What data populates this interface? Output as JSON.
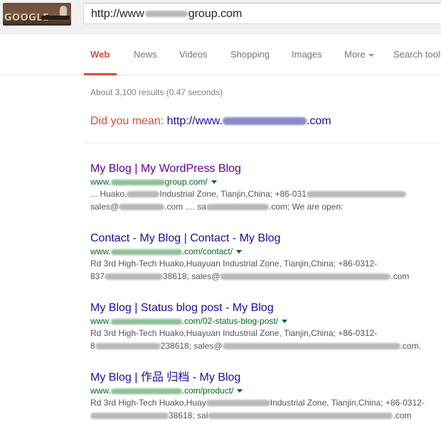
{
  "header": {
    "logo_text": "GOOGLE",
    "search_prefix": "http://www",
    "search_suffix": "group.com"
  },
  "nav": {
    "tabs": [
      {
        "label": "Web",
        "active": true
      },
      {
        "label": "News"
      },
      {
        "label": "Videos"
      },
      {
        "label": "Shopping"
      },
      {
        "label": "Images"
      },
      {
        "label": "More"
      },
      {
        "label": "Search tools"
      }
    ]
  },
  "stats": "About 3,100 results (0.47 seconds)",
  "did_you_mean": {
    "label": "Did you mean:",
    "prefix": "http://www.",
    "suffix": ".com"
  },
  "results": [
    {
      "title": "My Blog | My WordPress Blog",
      "url_prefix": "www.",
      "url_suffix": "group.com/",
      "snippet1_a": "... Huako,",
      "snippet1_b": "Industrial Zone, Tianjin,China; +86-031",
      "snippet2_a": "sales@",
      "snippet2_b": ".com .... sa",
      "snippet2_c": ".com; We are open:"
    },
    {
      "title": "Contact - My Blog | Contact - My Blog",
      "url_prefix": "www.",
      "url_suffix": ".com/contact/",
      "snippet1_a": "Rd 3rd High-Tech Huako,Huayuan Industrial Zone, Tianjin,China; +86-0312-",
      "snippet1_b": "",
      "snippet2_a": "837",
      "snippet2_b": "38618; sales@",
      "snippet2_c": ".com"
    },
    {
      "title": "My Blog | Status blog post - My Blog",
      "url_prefix": "www.",
      "url_suffix": ".com/02-status-blog-post/",
      "snippet1_a": "Rd 3rd High-Tech Huako,Huayuan Industrial Zone, Tianjin,China; +86-0312-",
      "snippet1_b": "",
      "snippet2_a": "8",
      "snippet2_b": "238618; sales@",
      "snippet2_c": ".com."
    },
    {
      "title": "My Blog | 作品 归档 - My Blog",
      "url_prefix": "www.",
      "url_suffix": ".com/product/",
      "snippet1_a": "Rd 3rd High-Tech Huako,Huay",
      "snippet1_b": "Industrial Zone, Tianjin,China; +86-0312-",
      "snippet2_a": "",
      "snippet2_b": "38618; sal",
      "snippet2_c": ".com"
    }
  ],
  "colors": {
    "accent": "#dd4b39",
    "link": "#1a0dab",
    "visited": "#660099",
    "url_green": "#006621"
  }
}
